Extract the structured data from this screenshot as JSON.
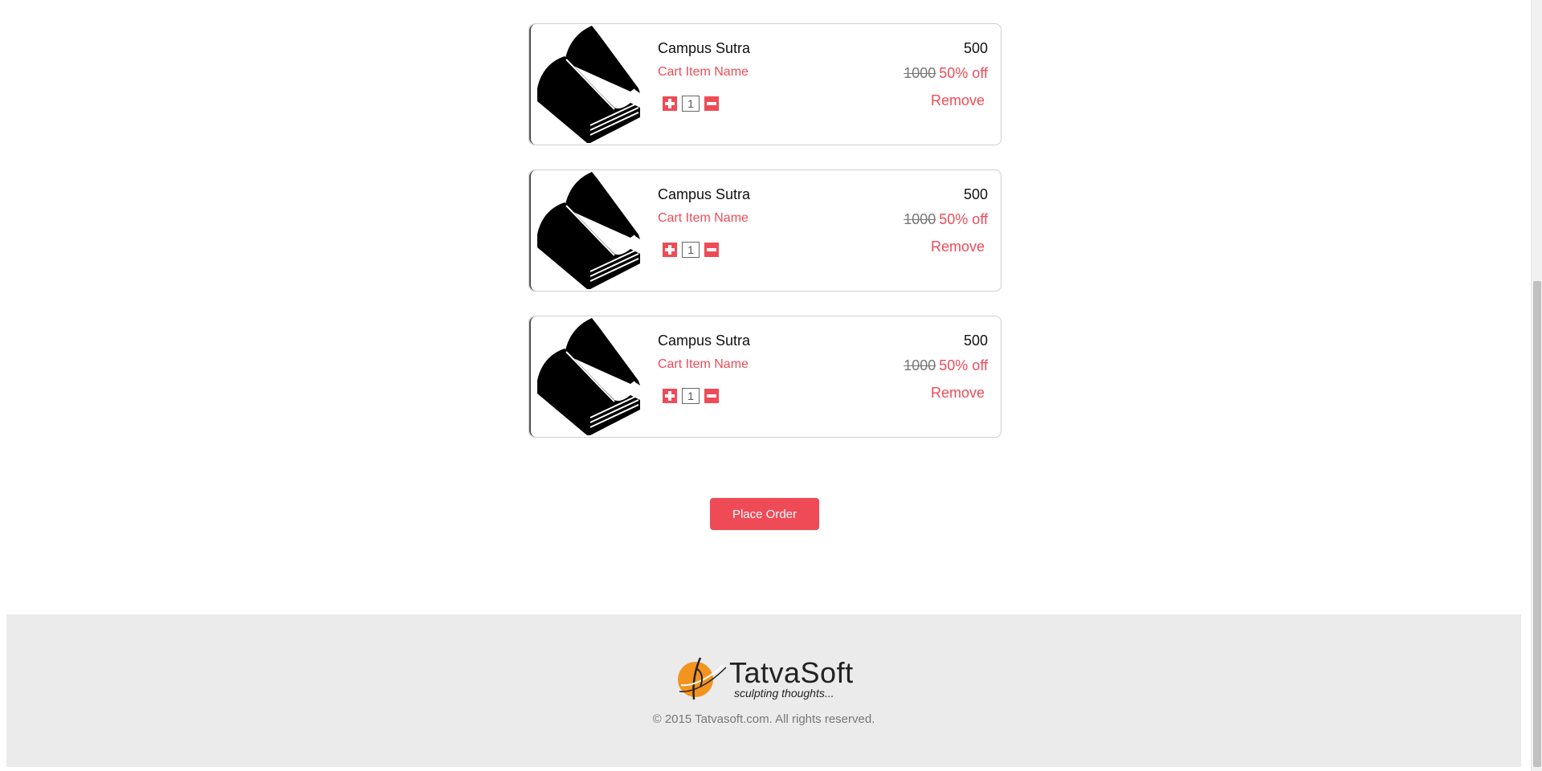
{
  "cart": {
    "items": [
      {
        "title": "Campus Sutra",
        "subtitle": "Cart Item Name",
        "quantity": "1",
        "price": "500",
        "old_price": "1000",
        "discount": "50% off",
        "remove_label": "Remove"
      },
      {
        "title": "Campus Sutra",
        "subtitle": "Cart Item Name",
        "quantity": "1",
        "price": "500",
        "old_price": "1000",
        "discount": "50% off",
        "remove_label": "Remove"
      },
      {
        "title": "Campus Sutra",
        "subtitle": "Cart Item Name",
        "quantity": "1",
        "price": "500",
        "old_price": "1000",
        "discount": "50% off",
        "remove_label": "Remove"
      }
    ],
    "place_order_label": "Place Order"
  },
  "footer": {
    "brand": "TatvaSoft",
    "tagline": "sculpting thoughts...",
    "copyright": "© 2015 Tatvasoft.com. All rights reserved."
  },
  "icons": {
    "product": "book-icon",
    "increase": "plus-icon",
    "decrease": "minus-icon",
    "logo": "tatvasoft-logo-icon"
  },
  "colors": {
    "accent": "#ef4b57",
    "footer_bg": "#ebebeb",
    "logo_orange": "#f2941f"
  }
}
